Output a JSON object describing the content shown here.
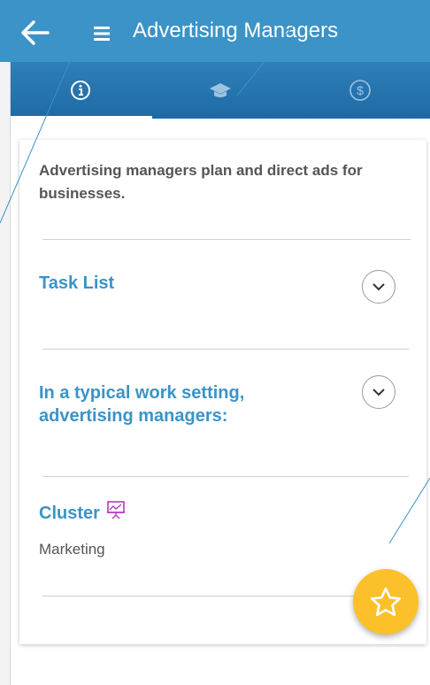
{
  "header": {
    "title": "Advertising Managers"
  },
  "tabs": [
    {
      "icon": "info-icon",
      "selected": true
    },
    {
      "icon": "graduation-cap-icon",
      "selected": false
    },
    {
      "icon": "dollar-icon",
      "selected": false
    }
  ],
  "content": {
    "intro": "Advertising managers plan and direct ads for businesses.",
    "sections": [
      {
        "title": "Task List"
      },
      {
        "title": "In a typical work setting, advertising managers:"
      }
    ],
    "cluster": {
      "label": "Cluster",
      "value": "Marketing",
      "icon": "presentation-chart-icon"
    }
  },
  "fab": {
    "icon": "star-icon"
  },
  "colors": {
    "appbar": "#3b93c7",
    "tabbar": "#2f7fb8",
    "accent": "#3b93c7",
    "fab": "#fcc02a",
    "cluster_icon": "#b03cc0"
  }
}
